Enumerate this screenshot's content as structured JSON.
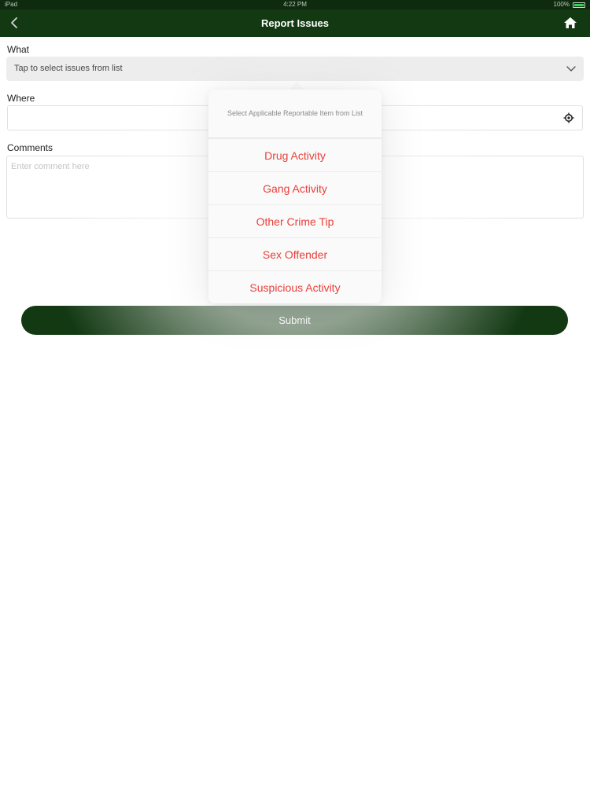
{
  "status_bar": {
    "left": "iPad",
    "time": "4:22 PM",
    "battery": "100%"
  },
  "nav": {
    "title": "Report Issues",
    "back_icon": "chevron-left-icon",
    "home_icon": "home-icon"
  },
  "form": {
    "what_label": "What",
    "what_placeholder": "Tap to select issues from list",
    "where_label": "Where",
    "where_value": "",
    "comments_label": "Comments",
    "comments_placeholder": "Enter comment here",
    "submit_label": "Submit"
  },
  "popover": {
    "header": "Select Applicable Reportable Item from List",
    "options": [
      "Drug Activity",
      "Gang Activity",
      "Other Crime Tip",
      "Sex Offender",
      "Suspicious Activity"
    ]
  },
  "colors": {
    "nav": "#133913",
    "option_text": "#e8403a",
    "battery": "#39d353"
  }
}
